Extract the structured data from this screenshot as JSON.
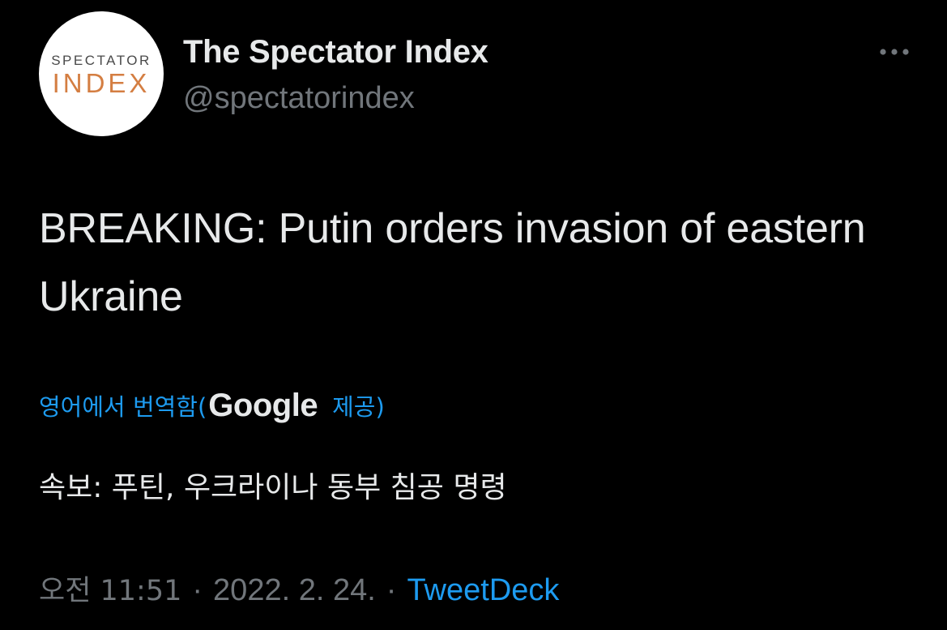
{
  "author": {
    "display_name": "The Spectator Index",
    "handle": "@spectatorindex",
    "avatar": {
      "line1": "SPECTATOR",
      "line2": "INDEX",
      "line1_color": "#4a4a4a",
      "line2_color": "#d47e42"
    }
  },
  "more_icon": "more-horizontal-icon",
  "tweet": {
    "text": "BREAKING: Putin orders invasion of eastern Ukraine",
    "translation": {
      "prefix": "영어에서 번역함(",
      "provider": "Google",
      "suffix": " 제공)",
      "text": "속보: 푸틴, 우크라이나 동부 침공 명령"
    },
    "time": "오전 11:51",
    "separator": "·",
    "date": "2022. 2. 24.",
    "source": "TweetDeck"
  },
  "colors": {
    "background": "#000000",
    "primary_text": "#e7e9ea",
    "secondary_text": "#71767b",
    "link": "#1d9bf0"
  }
}
